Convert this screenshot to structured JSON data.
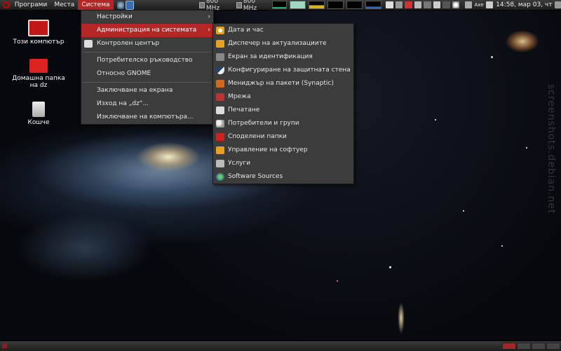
{
  "top_panel": {
    "menus": [
      "Програми",
      "Места",
      "Система"
    ],
    "cpu1": "800 MHz",
    "cpu2": "800 MHz",
    "keyboard": "Ахе",
    "clock": "14:58, мар 03, чт"
  },
  "desktop": {
    "icons": [
      {
        "label": "Този компютър"
      },
      {
        "label": "Домашна папка на dz"
      },
      {
        "label": "Кошче"
      }
    ]
  },
  "system_menu": {
    "items": [
      "Настройки",
      "Администрация на системата",
      "Контролен център",
      "Потребителско ръководство",
      "Относно GNOME",
      "Заключване на екрана",
      "Изход на „dz“...",
      "Изключване на компютъра..."
    ]
  },
  "admin_submenu": {
    "items": [
      {
        "label": "Дата и час",
        "icon": "clock-icon"
      },
      {
        "label": "Диспечер на актуализациите",
        "icon": "update-icon"
      },
      {
        "label": "Екран за идентификация",
        "icon": "login-screen-icon"
      },
      {
        "label": "Конфигуриране на защитната стена",
        "icon": "firewall-icon"
      },
      {
        "label": "Мениджър на пакети (Synaptic)",
        "icon": "package-icon"
      },
      {
        "label": "Мрежа",
        "icon": "network-icon"
      },
      {
        "label": "Печатане",
        "icon": "printer-icon"
      },
      {
        "label": "Потребители и групи",
        "icon": "users-icon"
      },
      {
        "label": "Споделени папки",
        "icon": "shared-folder-icon"
      },
      {
        "label": "Управление на софтуер",
        "icon": "software-icon"
      },
      {
        "label": "Услуги",
        "icon": "services-icon"
      },
      {
        "label": "Software Sources",
        "icon": "software-sources-icon"
      }
    ]
  },
  "watermark": "screenshots.debian.net",
  "colors": {
    "highlight": "#b52626",
    "menu_bg": "#3c3c3c",
    "panel_bg": "#2a2a2a"
  }
}
